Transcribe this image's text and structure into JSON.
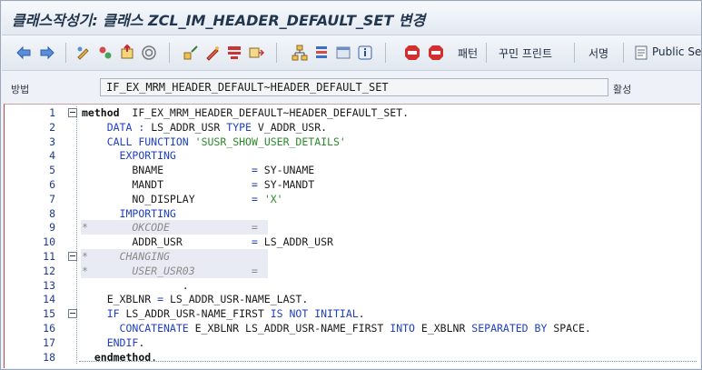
{
  "window": {
    "title": "클래스작성기: 클래스 ZCL_IM_HEADER_DEFAULT_SET 변경"
  },
  "toolbar": {
    "icons": [
      "back-arrow-icon",
      "forward-arrow-icon",
      "edit-toggle-icon",
      "other-object-icon",
      "activate-icon",
      "where-used-icon",
      "hierarchy-icon",
      "pencil-icon",
      "check-icon",
      "insert-icon",
      "tree-icon",
      "outline-icon",
      "window-icon",
      "info-icon",
      "stop-icon",
      "stop-check-icon"
    ],
    "pattern_label": "패턴",
    "pretty_print_label": "꾸민 프린트",
    "signature_label": "서명",
    "public_section_label": "Public Se"
  },
  "method_bar": {
    "label": "방법",
    "value": "IF_EX_MRM_HEADER_DEFAULT~HEADER_DEFAULT_SET",
    "status_label": "활성"
  },
  "code": {
    "lines": [
      {
        "n": "1",
        "fold": true,
        "hl": false,
        "parts": [
          [
            "bold",
            "method"
          ],
          [
            "",
            "  IF_EX_MRM_HEADER_DEFAULT~HEADER_DEFAULT_SET."
          ]
        ]
      },
      {
        "n": "2",
        "fold": false,
        "hl": false,
        "parts": [
          [
            "",
            "    "
          ],
          [
            "kw",
            "DATA"
          ],
          [
            "kw",
            " :"
          ],
          [
            "",
            " LS_ADDR_USR "
          ],
          [
            "kw",
            "TYPE"
          ],
          [
            "",
            " V_ADDR_USR."
          ]
        ]
      },
      {
        "n": "3",
        "fold": false,
        "hl": false,
        "parts": [
          [
            "",
            "    "
          ],
          [
            "kw",
            "CALL FUNCTION"
          ],
          [
            "",
            " "
          ],
          [
            "str",
            "'SUSR_SHOW_USER_DETAILS'"
          ]
        ]
      },
      {
        "n": "4",
        "fold": false,
        "hl": false,
        "parts": [
          [
            "",
            "      "
          ],
          [
            "kw",
            "EXPORTING"
          ]
        ]
      },
      {
        "n": "5",
        "fold": false,
        "hl": false,
        "parts": [
          [
            "",
            "        BNAME              "
          ],
          [
            "kw",
            "="
          ],
          [
            "",
            " SY-UNAME"
          ]
        ]
      },
      {
        "n": "6",
        "fold": false,
        "hl": false,
        "parts": [
          [
            "",
            "        MANDT              "
          ],
          [
            "kw",
            "="
          ],
          [
            "",
            " SY-MANDT"
          ]
        ]
      },
      {
        "n": "7",
        "fold": false,
        "hl": false,
        "parts": [
          [
            "",
            "        NO_DISPLAY         "
          ],
          [
            "kw",
            "="
          ],
          [
            "",
            " "
          ],
          [
            "str",
            "'X'"
          ]
        ]
      },
      {
        "n": "8",
        "fold": false,
        "hl": false,
        "parts": [
          [
            "",
            "      "
          ],
          [
            "kw",
            "IMPORTING"
          ]
        ]
      },
      {
        "n": "9",
        "fold": false,
        "hl": true,
        "parts": [
          [
            "cm",
            "*       OKCODE             ="
          ]
        ]
      },
      {
        "n": "10",
        "fold": false,
        "hl": false,
        "parts": [
          [
            "",
            "        ADDR_USR           "
          ],
          [
            "kw",
            "="
          ],
          [
            "",
            " LS_ADDR_USR"
          ]
        ]
      },
      {
        "n": "11",
        "fold": true,
        "hl": true,
        "parts": [
          [
            "cm",
            "*     CHANGING"
          ]
        ]
      },
      {
        "n": "12",
        "fold": false,
        "hl": true,
        "parts": [
          [
            "cm",
            "*       USER_USR03         ="
          ]
        ]
      },
      {
        "n": "13",
        "fold": false,
        "hl": false,
        "parts": [
          [
            "",
            "                .  "
          ]
        ]
      },
      {
        "n": "14",
        "fold": false,
        "hl": false,
        "parts": [
          [
            "",
            "    E_XBLNR "
          ],
          [
            "kw",
            "="
          ],
          [
            "",
            " LS_ADDR_USR-NAME_LAST."
          ]
        ]
      },
      {
        "n": "15",
        "fold": true,
        "hl": false,
        "parts": [
          [
            "",
            "    "
          ],
          [
            "kw",
            "IF"
          ],
          [
            "",
            " LS_ADDR_USR-NAME_FIRST "
          ],
          [
            "kw",
            "IS NOT INITIAL"
          ],
          [
            "",
            "."
          ]
        ]
      },
      {
        "n": "16",
        "fold": false,
        "hl": false,
        "parts": [
          [
            "",
            "      "
          ],
          [
            "kw",
            "CONCATENATE"
          ],
          [
            "",
            " E_XBLNR LS_ADDR_USR-NAME_FIRST "
          ],
          [
            "kw",
            "INTO"
          ],
          [
            "",
            " E_XBLNR "
          ],
          [
            "kw",
            "SEPARATED BY"
          ],
          [
            "",
            " SPACE."
          ]
        ]
      },
      {
        "n": "17",
        "fold": false,
        "hl": false,
        "parts": [
          [
            "",
            "    "
          ],
          [
            "kw",
            "ENDIF"
          ],
          [
            "",
            "."
          ]
        ]
      },
      {
        "n": "18",
        "fold": false,
        "hl": false,
        "parts": [
          [
            "",
            "  "
          ],
          [
            "bold",
            "endmethod"
          ],
          [
            "",
            "."
          ]
        ]
      }
    ]
  },
  "colors": {
    "keyword": "#1f3fbf",
    "string": "#2c8a2c",
    "comment": "#8a8a8a",
    "line_number": "#1f3a8a"
  }
}
